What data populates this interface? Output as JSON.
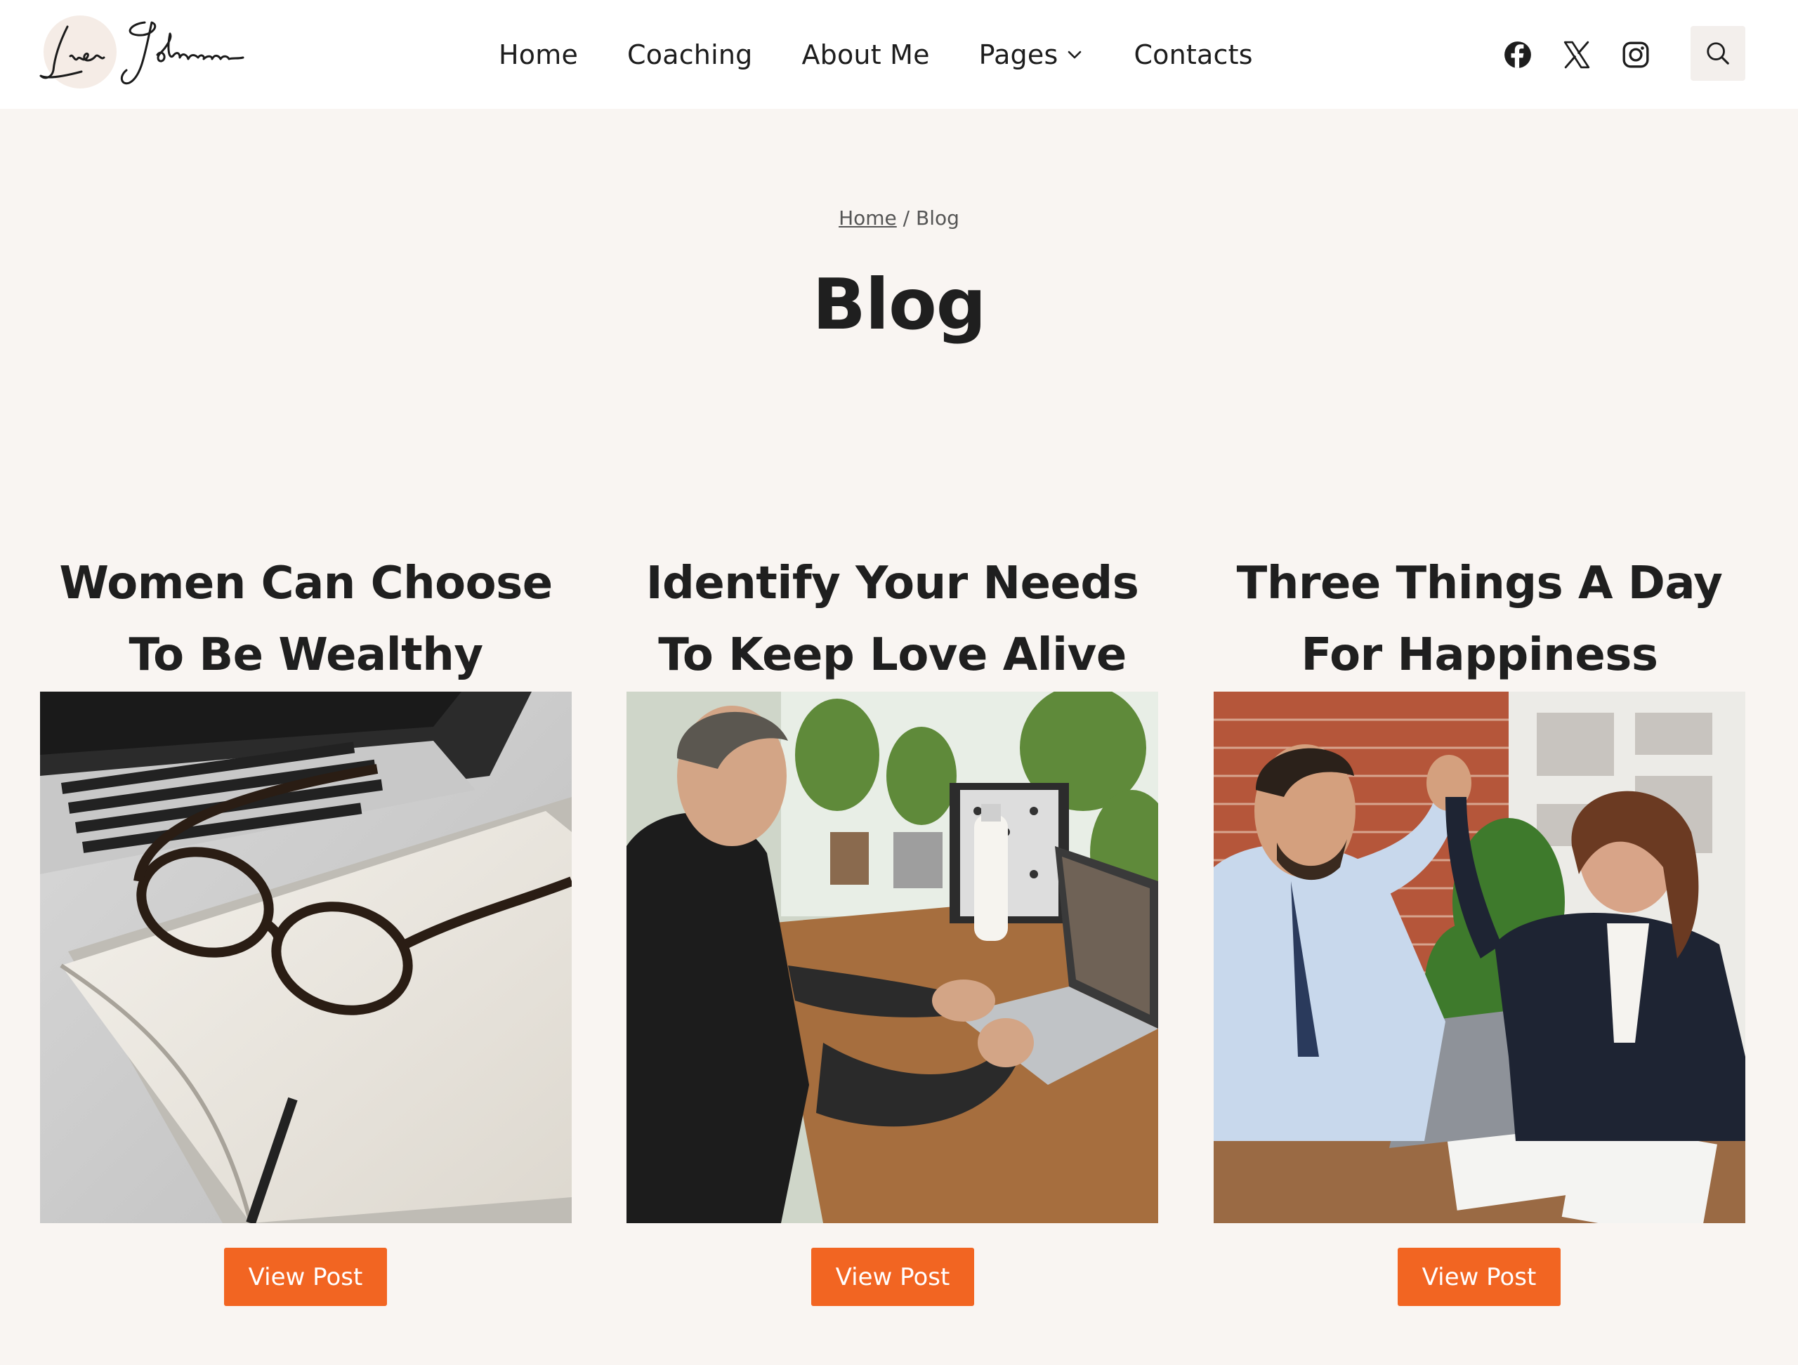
{
  "header": {
    "logo_text": "Lisa Johnson",
    "nav": [
      {
        "label": "Home"
      },
      {
        "label": "Coaching"
      },
      {
        "label": "About Me"
      },
      {
        "label": "Pages",
        "has_dropdown": true
      },
      {
        "label": "Contacts"
      }
    ],
    "social_icons": [
      "facebook-icon",
      "x-twitter-icon",
      "instagram-icon"
    ],
    "search_icon": "search-icon"
  },
  "breadcrumb": {
    "home": "Home",
    "separator": "/",
    "current": "Blog"
  },
  "page_title": "Blog",
  "posts": [
    {
      "title": "Women Can Choose To Be Wealthy",
      "image": "glasses-on-notebook-photo",
      "button": "View Post"
    },
    {
      "title": "Identify Your Needs To Keep Love Alive",
      "image": "man-on-video-call-photo",
      "button": "View Post"
    },
    {
      "title": "Three Things A Day For Happiness",
      "image": "colleagues-high-five-photo",
      "button": "View Post"
    }
  ],
  "colors": {
    "accent": "#f26522",
    "page_bg": "#f9f5f2",
    "header_bg": "#ffffff",
    "text": "#1f1f1f"
  }
}
